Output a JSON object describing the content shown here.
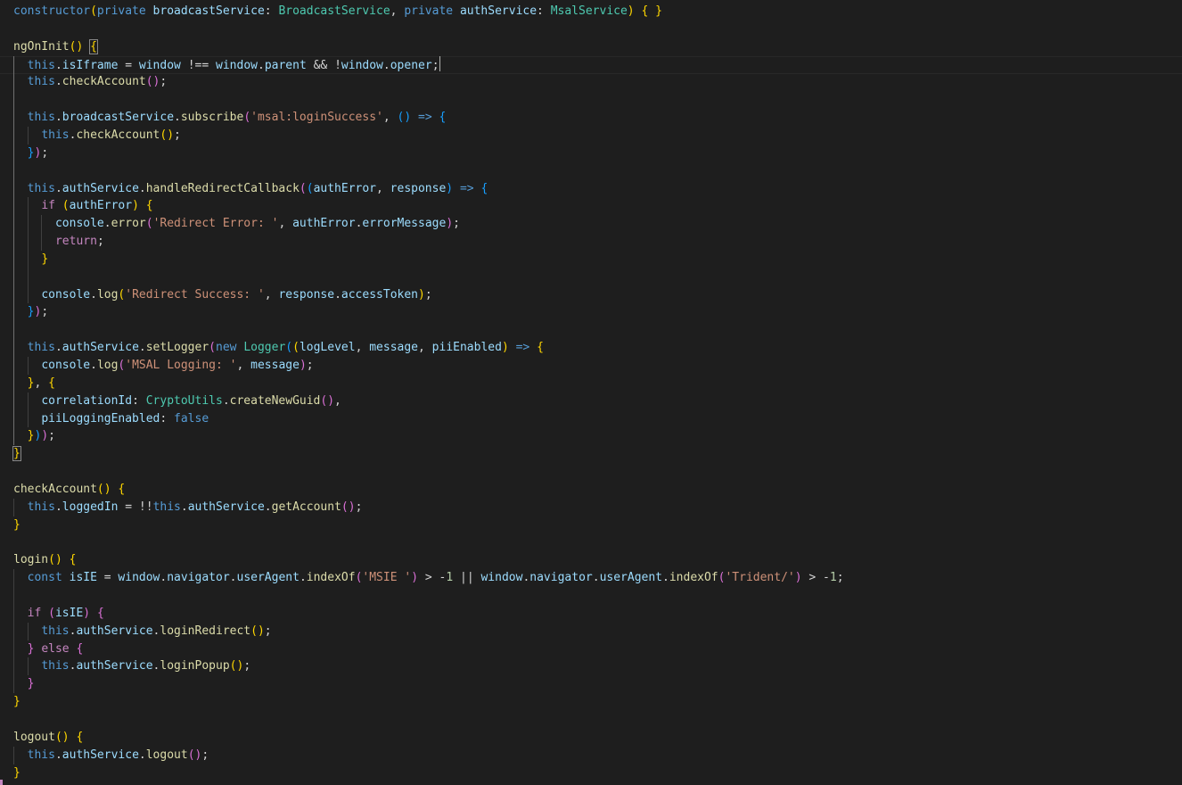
{
  "editor": {
    "colors": {
      "background": "#1e1e1e",
      "default": "#d4d4d4",
      "keyword": "#569cd6",
      "control": "#c586c0",
      "function": "#dcdcaa",
      "variable": "#9cdcfe",
      "type": "#4ec9b0",
      "string": "#ce9178",
      "number": "#b5cea8",
      "bracket_gold": "#ffd700",
      "bracket_orchid": "#da70d6",
      "bracket_blue": "#179fff",
      "param": "#9cdcfe"
    },
    "lines": [
      [
        [
          "constructor",
          "keyword"
        ],
        [
          "(",
          "bracket_gold"
        ],
        [
          "private ",
          "keyword"
        ],
        [
          "broadcastService",
          "variable"
        ],
        [
          ": ",
          "default"
        ],
        [
          "BroadcastService",
          "type"
        ],
        [
          ", ",
          "default"
        ],
        [
          "private ",
          "keyword"
        ],
        [
          "authService",
          "variable"
        ],
        [
          ": ",
          "default"
        ],
        [
          "MsalService",
          "type"
        ],
        [
          ") ",
          "bracket_gold"
        ],
        [
          "{ }",
          "bracket_gold"
        ]
      ],
      [],
      [
        [
          "ngOnInit",
          "function"
        ],
        [
          "()",
          "bracket_gold"
        ],
        [
          " ",
          "default"
        ],
        [
          "{",
          "bracket_gold"
        ]
      ],
      [
        [
          "  ",
          "default"
        ],
        [
          "this",
          "keyword"
        ],
        [
          ".",
          "default"
        ],
        [
          "isIframe",
          "variable"
        ],
        [
          " = ",
          "default"
        ],
        [
          "window",
          "variable"
        ],
        [
          " !== ",
          "default"
        ],
        [
          "window",
          "variable"
        ],
        [
          ".",
          "default"
        ],
        [
          "parent",
          "variable"
        ],
        [
          " && !",
          "default"
        ],
        [
          "window",
          "variable"
        ],
        [
          ".",
          "default"
        ],
        [
          "opener",
          "variable"
        ],
        [
          ";",
          "default"
        ]
      ],
      [
        [
          "  ",
          "default"
        ],
        [
          "this",
          "keyword"
        ],
        [
          ".",
          "default"
        ],
        [
          "checkAccount",
          "function"
        ],
        [
          "()",
          "bracket_orchid"
        ],
        [
          ";",
          "default"
        ]
      ],
      [],
      [
        [
          "  ",
          "default"
        ],
        [
          "this",
          "keyword"
        ],
        [
          ".",
          "default"
        ],
        [
          "broadcastService",
          "variable"
        ],
        [
          ".",
          "default"
        ],
        [
          "subscribe",
          "function"
        ],
        [
          "(",
          "bracket_orchid"
        ],
        [
          "'msal:loginSuccess'",
          "string"
        ],
        [
          ", ",
          "default"
        ],
        [
          "()",
          "bracket_blue"
        ],
        [
          " => ",
          "keyword"
        ],
        [
          "{",
          "bracket_blue"
        ]
      ],
      [
        [
          "    ",
          "default"
        ],
        [
          "this",
          "keyword"
        ],
        [
          ".",
          "default"
        ],
        [
          "checkAccount",
          "function"
        ],
        [
          "()",
          "bracket_gold"
        ],
        [
          ";",
          "default"
        ]
      ],
      [
        [
          "  ",
          "default"
        ],
        [
          "}",
          "bracket_blue"
        ],
        [
          ")",
          "bracket_orchid"
        ],
        [
          ";",
          "default"
        ]
      ],
      [],
      [
        [
          "  ",
          "default"
        ],
        [
          "this",
          "keyword"
        ],
        [
          ".",
          "default"
        ],
        [
          "authService",
          "variable"
        ],
        [
          ".",
          "default"
        ],
        [
          "handleRedirectCallback",
          "function"
        ],
        [
          "(",
          "bracket_orchid"
        ],
        [
          "(",
          "bracket_blue"
        ],
        [
          "authError",
          "param"
        ],
        [
          ", ",
          "default"
        ],
        [
          "response",
          "param"
        ],
        [
          ")",
          "bracket_blue"
        ],
        [
          " => ",
          "keyword"
        ],
        [
          "{",
          "bracket_blue"
        ]
      ],
      [
        [
          "    ",
          "default"
        ],
        [
          "if ",
          "control"
        ],
        [
          "(",
          "bracket_gold"
        ],
        [
          "authError",
          "variable"
        ],
        [
          ") ",
          "bracket_gold"
        ],
        [
          "{",
          "bracket_gold"
        ]
      ],
      [
        [
          "      ",
          "default"
        ],
        [
          "console",
          "variable"
        ],
        [
          ".",
          "default"
        ],
        [
          "error",
          "function"
        ],
        [
          "(",
          "bracket_orchid"
        ],
        [
          "'Redirect Error: '",
          "string"
        ],
        [
          ", ",
          "default"
        ],
        [
          "authError",
          "variable"
        ],
        [
          ".",
          "default"
        ],
        [
          "errorMessage",
          "variable"
        ],
        [
          ")",
          "bracket_orchid"
        ],
        [
          ";",
          "default"
        ]
      ],
      [
        [
          "      ",
          "default"
        ],
        [
          "return",
          "control"
        ],
        [
          ";",
          "default"
        ]
      ],
      [
        [
          "    ",
          "default"
        ],
        [
          "}",
          "bracket_gold"
        ]
      ],
      [],
      [
        [
          "    ",
          "default"
        ],
        [
          "console",
          "variable"
        ],
        [
          ".",
          "default"
        ],
        [
          "log",
          "function"
        ],
        [
          "(",
          "bracket_gold"
        ],
        [
          "'Redirect Success: '",
          "string"
        ],
        [
          ", ",
          "default"
        ],
        [
          "response",
          "variable"
        ],
        [
          ".",
          "default"
        ],
        [
          "accessToken",
          "variable"
        ],
        [
          ")",
          "bracket_gold"
        ],
        [
          ";",
          "default"
        ]
      ],
      [
        [
          "  ",
          "default"
        ],
        [
          "}",
          "bracket_blue"
        ],
        [
          ")",
          "bracket_orchid"
        ],
        [
          ";",
          "default"
        ]
      ],
      [],
      [
        [
          "  ",
          "default"
        ],
        [
          "this",
          "keyword"
        ],
        [
          ".",
          "default"
        ],
        [
          "authService",
          "variable"
        ],
        [
          ".",
          "default"
        ],
        [
          "setLogger",
          "function"
        ],
        [
          "(",
          "bracket_orchid"
        ],
        [
          "new ",
          "keyword"
        ],
        [
          "Logger",
          "type"
        ],
        [
          "(",
          "bracket_blue"
        ],
        [
          "(",
          "bracket_gold"
        ],
        [
          "logLevel",
          "param"
        ],
        [
          ", ",
          "default"
        ],
        [
          "message",
          "param"
        ],
        [
          ", ",
          "default"
        ],
        [
          "piiEnabled",
          "param"
        ],
        [
          ")",
          "bracket_gold"
        ],
        [
          " => ",
          "keyword"
        ],
        [
          "{",
          "bracket_gold"
        ]
      ],
      [
        [
          "    ",
          "default"
        ],
        [
          "console",
          "variable"
        ],
        [
          ".",
          "default"
        ],
        [
          "log",
          "function"
        ],
        [
          "(",
          "bracket_orchid"
        ],
        [
          "'MSAL Logging: '",
          "string"
        ],
        [
          ", ",
          "default"
        ],
        [
          "message",
          "variable"
        ],
        [
          ")",
          "bracket_orchid"
        ],
        [
          ";",
          "default"
        ]
      ],
      [
        [
          "  ",
          "default"
        ],
        [
          "}",
          "bracket_gold"
        ],
        [
          ", ",
          "default"
        ],
        [
          "{",
          "bracket_gold"
        ]
      ],
      [
        [
          "    ",
          "default"
        ],
        [
          "correlationId",
          "variable"
        ],
        [
          ": ",
          "default"
        ],
        [
          "CryptoUtils",
          "type"
        ],
        [
          ".",
          "default"
        ],
        [
          "createNewGuid",
          "function"
        ],
        [
          "()",
          "bracket_orchid"
        ],
        [
          ",",
          "default"
        ]
      ],
      [
        [
          "    ",
          "default"
        ],
        [
          "piiLoggingEnabled",
          "variable"
        ],
        [
          ": ",
          "default"
        ],
        [
          "false",
          "keyword"
        ]
      ],
      [
        [
          "  ",
          "default"
        ],
        [
          "}",
          "bracket_gold"
        ],
        [
          ")",
          "bracket_blue"
        ],
        [
          ")",
          "bracket_orchid"
        ],
        [
          ";",
          "default"
        ]
      ],
      [
        [
          "}",
          "bracket_gold"
        ]
      ],
      [],
      [
        [
          "checkAccount",
          "function"
        ],
        [
          "()",
          "bracket_gold"
        ],
        [
          " ",
          "default"
        ],
        [
          "{",
          "bracket_gold"
        ]
      ],
      [
        [
          "  ",
          "default"
        ],
        [
          "this",
          "keyword"
        ],
        [
          ".",
          "default"
        ],
        [
          "loggedIn",
          "variable"
        ],
        [
          " = !!",
          "default"
        ],
        [
          "this",
          "keyword"
        ],
        [
          ".",
          "default"
        ],
        [
          "authService",
          "variable"
        ],
        [
          ".",
          "default"
        ],
        [
          "getAccount",
          "function"
        ],
        [
          "()",
          "bracket_orchid"
        ],
        [
          ";",
          "default"
        ]
      ],
      [
        [
          "}",
          "bracket_gold"
        ]
      ],
      [],
      [
        [
          "login",
          "function"
        ],
        [
          "()",
          "bracket_gold"
        ],
        [
          " ",
          "default"
        ],
        [
          "{",
          "bracket_gold"
        ]
      ],
      [
        [
          "  ",
          "default"
        ],
        [
          "const ",
          "keyword"
        ],
        [
          "isIE",
          "variable"
        ],
        [
          " = ",
          "default"
        ],
        [
          "window",
          "variable"
        ],
        [
          ".",
          "default"
        ],
        [
          "navigator",
          "variable"
        ],
        [
          ".",
          "default"
        ],
        [
          "userAgent",
          "variable"
        ],
        [
          ".",
          "default"
        ],
        [
          "indexOf",
          "function"
        ],
        [
          "(",
          "bracket_orchid"
        ],
        [
          "'MSIE '",
          "string"
        ],
        [
          ")",
          "bracket_orchid"
        ],
        [
          " > -",
          "default"
        ],
        [
          "1",
          "number"
        ],
        [
          " || ",
          "default"
        ],
        [
          "window",
          "variable"
        ],
        [
          ".",
          "default"
        ],
        [
          "navigator",
          "variable"
        ],
        [
          ".",
          "default"
        ],
        [
          "userAgent",
          "variable"
        ],
        [
          ".",
          "default"
        ],
        [
          "indexOf",
          "function"
        ],
        [
          "(",
          "bracket_orchid"
        ],
        [
          "'Trident/'",
          "string"
        ],
        [
          ")",
          "bracket_orchid"
        ],
        [
          " > -",
          "default"
        ],
        [
          "1",
          "number"
        ],
        [
          ";",
          "default"
        ]
      ],
      [],
      [
        [
          "  ",
          "default"
        ],
        [
          "if ",
          "control"
        ],
        [
          "(",
          "bracket_orchid"
        ],
        [
          "isIE",
          "variable"
        ],
        [
          ") ",
          "bracket_orchid"
        ],
        [
          "{",
          "bracket_orchid"
        ]
      ],
      [
        [
          "    ",
          "default"
        ],
        [
          "this",
          "keyword"
        ],
        [
          ".",
          "default"
        ],
        [
          "authService",
          "variable"
        ],
        [
          ".",
          "default"
        ],
        [
          "loginRedirect",
          "function"
        ],
        [
          "()",
          "bracket_gold"
        ],
        [
          ";",
          "default"
        ]
      ],
      [
        [
          "  ",
          "default"
        ],
        [
          "} ",
          "bracket_orchid"
        ],
        [
          "else ",
          "control"
        ],
        [
          "{",
          "bracket_orchid"
        ]
      ],
      [
        [
          "    ",
          "default"
        ],
        [
          "this",
          "keyword"
        ],
        [
          ".",
          "default"
        ],
        [
          "authService",
          "variable"
        ],
        [
          ".",
          "default"
        ],
        [
          "loginPopup",
          "function"
        ],
        [
          "()",
          "bracket_gold"
        ],
        [
          ";",
          "default"
        ]
      ],
      [
        [
          "  ",
          "default"
        ],
        [
          "}",
          "bracket_orchid"
        ]
      ],
      [
        [
          "}",
          "bracket_gold"
        ]
      ],
      [],
      [
        [
          "logout",
          "function"
        ],
        [
          "()",
          "bracket_gold"
        ],
        [
          " ",
          "default"
        ],
        [
          "{",
          "bracket_gold"
        ]
      ],
      [
        [
          "  ",
          "default"
        ],
        [
          "this",
          "keyword"
        ],
        [
          ".",
          "default"
        ],
        [
          "authService",
          "variable"
        ],
        [
          ".",
          "default"
        ],
        [
          "logout",
          "function"
        ],
        [
          "()",
          "bracket_orchid"
        ],
        [
          ";",
          "default"
        ]
      ],
      [
        [
          "}",
          "bracket_gold"
        ]
      ]
    ]
  }
}
